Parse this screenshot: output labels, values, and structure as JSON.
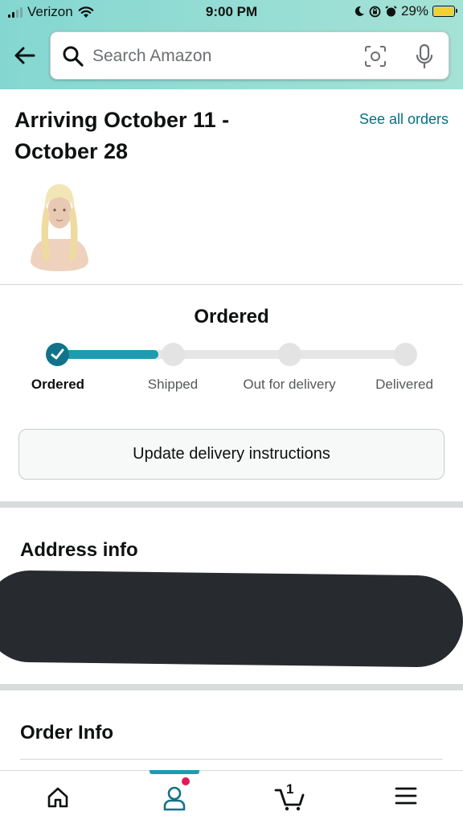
{
  "status_bar": {
    "carrier": "Verizon",
    "time": "9:00 PM",
    "battery": "29%",
    "battery_color": "#f2d031"
  },
  "header": {
    "search_placeholder": "Search Amazon",
    "back_icon": "arrow-left-icon",
    "search_icon": "magnifier-icon",
    "camera_icon": "camera-scan-icon",
    "mic_icon": "microphone-icon",
    "gradient_colors": [
      "#84d7d1",
      "#a5e2d6"
    ]
  },
  "arrival": {
    "title": "Arriving October 11 - October 28",
    "see_all_orders": "See all orders"
  },
  "progress": {
    "current_status": "Ordered",
    "steps": [
      "Ordered",
      "Shipped",
      "Out for delivery",
      "Delivered"
    ],
    "completed_steps": 1,
    "fill_fraction": 0.29,
    "accent_color": "#1d9bb0"
  },
  "actions": {
    "update_delivery": "Update delivery instructions"
  },
  "address": {
    "title": "Address info"
  },
  "order_info": {
    "title": "Order Info"
  },
  "tabbar": {
    "items": [
      "home-icon",
      "account-icon",
      "cart-icon",
      "menu-icon"
    ],
    "active": "account-icon",
    "cart_count": "1",
    "notification_color": "#e3195a"
  }
}
